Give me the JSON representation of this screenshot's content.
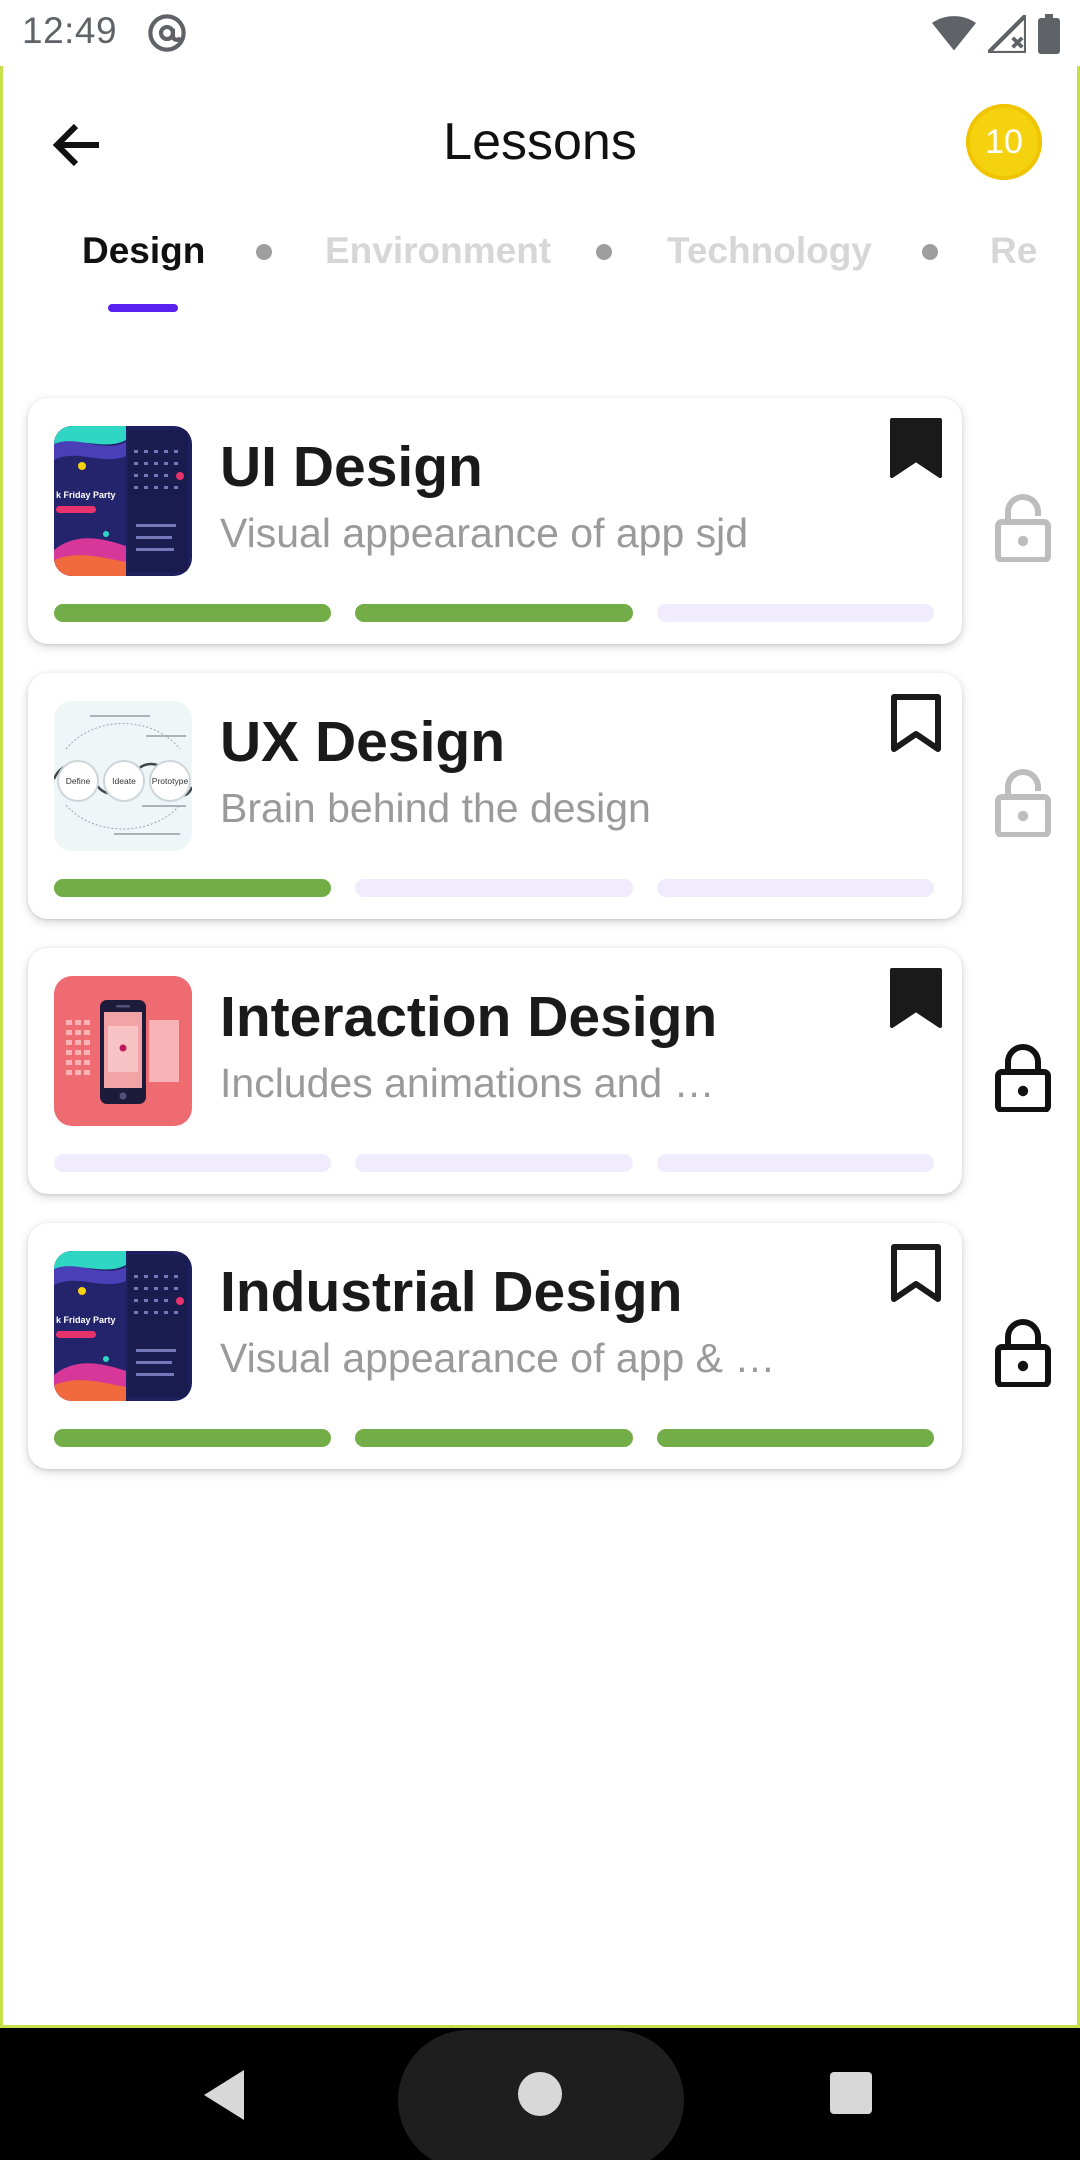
{
  "status_bar": {
    "time": "12:49",
    "icons": [
      "at-sign-icon",
      "wifi-icon",
      "signal-no-service-icon",
      "battery-icon"
    ]
  },
  "header": {
    "title": "Lessons",
    "coins": "10",
    "back_icon": "arrow-left-icon"
  },
  "tabs": [
    {
      "label": "Design",
      "active": true
    },
    {
      "label": "Environment",
      "active": false
    },
    {
      "label": "Technology",
      "active": false
    },
    {
      "label": "Re",
      "active": false
    }
  ],
  "colors": {
    "accent": "#5b21f0",
    "progress_done": "#72ad48",
    "progress_todo": "#f1ecfd",
    "coin": "#f5d20f",
    "frame": "#c6e04a"
  },
  "lessons": [
    {
      "title": "UI Design",
      "subtitle": "Visual appearance of app sjd",
      "thumbnail": "dark-app-mockup-thumbnail",
      "thumbnail_text": "k Friday Party",
      "bookmarked": true,
      "progress": [
        true,
        true,
        false
      ],
      "lock": "unlocked"
    },
    {
      "title": "UX Design",
      "subtitle": "Brain behind the design",
      "thumbnail": "ux-process-thumbnail",
      "thumbnail_text": [
        "Define",
        "Ideate",
        "Prototype"
      ],
      "bookmarked": false,
      "progress": [
        true,
        false,
        false
      ],
      "lock": "unlocked"
    },
    {
      "title": "Interaction Design",
      "subtitle": "Includes animations and …",
      "thumbnail": "phone-interaction-thumbnail",
      "bookmarked": true,
      "progress": [
        false,
        false,
        false
      ],
      "lock": "locked"
    },
    {
      "title": "Industrial Design",
      "subtitle": "Visual appearance of app & …",
      "thumbnail": "dark-app-mockup-thumbnail",
      "thumbnail_text": "k Friday Party",
      "bookmarked": false,
      "progress": [
        true,
        true,
        true
      ],
      "lock": "locked"
    }
  ],
  "nav_bar": {
    "icons": [
      "nav-back-icon",
      "nav-home-icon",
      "nav-recents-icon"
    ]
  }
}
